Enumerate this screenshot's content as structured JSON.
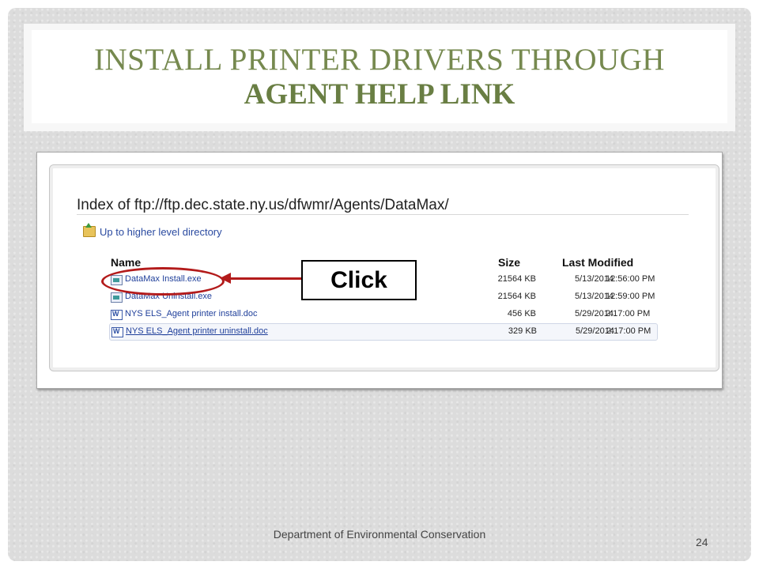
{
  "slide": {
    "title_line1": "INSTALL PRINTER DRIVERS THROUGH",
    "title_line2": "AGENT HELP LINK",
    "footer": "Department of Environmental Conservation",
    "page_number": "24",
    "accent_color": "#76894f"
  },
  "browser": {
    "index_heading": "Index of ftp://ftp.dec.state.ny.us/dfwmr/Agents/DataMax/",
    "up_link": "Up to higher level directory",
    "up_icon": "folder-up-icon",
    "columns": {
      "name": "Name",
      "size": "Size",
      "last_modified": "Last Modified"
    },
    "files": [
      {
        "name": "DataMax Install.exe",
        "size": "21564 KB",
        "date": "5/13/2014",
        "time": "12:56:00 PM",
        "icon": "exe-file-icon"
      },
      {
        "name": "DataMax Uninstall.exe",
        "size": "21564 KB",
        "date": "5/13/2014",
        "time": "12:59:00 PM",
        "icon": "exe-file-icon"
      },
      {
        "name": "NYS ELS_Agent printer install.doc",
        "size": "456 KB",
        "date": "5/29/2014",
        "time": "2:17:00 PM",
        "icon": "word-doc-icon"
      },
      {
        "name": "NYS ELS_Agent printer uninstall.doc",
        "size": "329 KB",
        "date": "5/29/2014",
        "time": "2:17:00 PM",
        "icon": "word-doc-icon"
      }
    ]
  },
  "callout": {
    "label": "Click",
    "color": "#b31b1b"
  }
}
